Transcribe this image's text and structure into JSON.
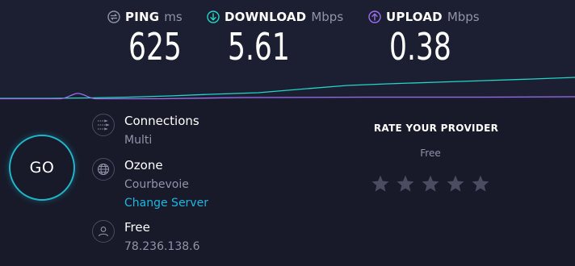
{
  "metrics": {
    "ping": {
      "label": "PING",
      "unit": "ms",
      "value": "625",
      "color": "#9193a8"
    },
    "download": {
      "label": "DOWNLOAD",
      "unit": "Mbps",
      "value": "5.61",
      "color": "#22d6c8"
    },
    "upload": {
      "label": "UPLOAD",
      "unit": "Mbps",
      "value": "0.38",
      "color": "#9b6ef0"
    }
  },
  "go_label": "GO",
  "connections": {
    "title": "Connections",
    "value": "Multi"
  },
  "server": {
    "name": "Ozone",
    "location": "Courbevoie",
    "change_link": "Change Server"
  },
  "isp": {
    "name": "Free",
    "ip": "78.236.138.6"
  },
  "rating": {
    "title": "RATE YOUR PROVIDER",
    "provider": "Free",
    "stars_total": 5,
    "stars_selected": 0
  },
  "colors": {
    "background": "#181a2a",
    "accent": "#1eb6c8",
    "download_line": "#22d6c8",
    "upload_line": "#9b6ef0",
    "star": "#4a4c61"
  },
  "icons": {
    "ping": "ping-icon",
    "download": "download-arrow-icon",
    "upload": "upload-arrow-icon",
    "connections": "connections-icon",
    "server": "globe-icon",
    "isp": "user-icon",
    "star": "star-icon"
  }
}
